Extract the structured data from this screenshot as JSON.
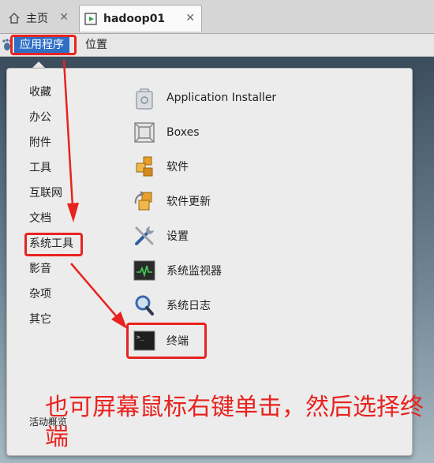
{
  "tabs": [
    {
      "label": "主页",
      "icon": "home-icon"
    },
    {
      "label": "hadoop01",
      "icon": "vm-icon"
    }
  ],
  "panel": {
    "applications_label": "应用程序",
    "places_label": "位置"
  },
  "categories": [
    "收藏",
    "办公",
    "附件",
    "工具",
    "互联网",
    "文档",
    "系统工具",
    "影音",
    "杂项",
    "其它"
  ],
  "apps": [
    {
      "label": "Application Installer",
      "icon": "package-icon"
    },
    {
      "label": "Boxes",
      "icon": "boxes-icon"
    },
    {
      "label": "软件",
      "icon": "software-icon"
    },
    {
      "label": "软件更新",
      "icon": "update-icon"
    },
    {
      "label": "设置",
      "icon": "settings-icon"
    },
    {
      "label": "系统监视器",
      "icon": "monitor-icon"
    },
    {
      "label": "系统日志",
      "icon": "log-icon"
    },
    {
      "label": "终端",
      "icon": "terminal-icon"
    }
  ],
  "activities_label": "活动概览",
  "annotation": {
    "text": "也可屏幕鼠标右键单击，然后选择终端",
    "color": "#e8231f"
  },
  "colors": {
    "accent": "#2f6ec5",
    "annotation": "#e8231f"
  }
}
